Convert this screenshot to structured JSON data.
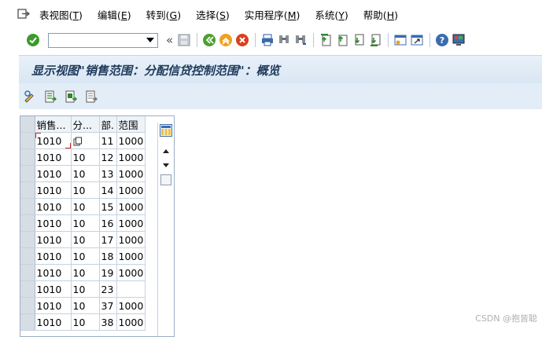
{
  "menu": {
    "items": [
      {
        "label": "表视图(",
        "key": "T",
        "end": ")"
      },
      {
        "label": "编辑(",
        "key": "E",
        "end": ")"
      },
      {
        "label": "转到(",
        "key": "G",
        "end": ")"
      },
      {
        "label": "选择(",
        "key": "S",
        "end": ")"
      },
      {
        "label": "实用程序(",
        "key": "M",
        "end": ")"
      },
      {
        "label": "系统(",
        "key": "Y",
        "end": ")"
      },
      {
        "label": "帮助(",
        "key": "H",
        "end": ")"
      }
    ]
  },
  "toolbar": {
    "command_value": "",
    "collapse_glyph": "«"
  },
  "title": "显示视图\"销售范围：分配信贷控制范围\"：概览",
  "table": {
    "columns": [
      "销售...",
      "分...",
      "部.",
      "范围"
    ],
    "rows": [
      [
        "1010",
        "",
        "11",
        "1000"
      ],
      [
        "1010",
        "10",
        "12",
        "1000"
      ],
      [
        "1010",
        "10",
        "13",
        "1000"
      ],
      [
        "1010",
        "10",
        "14",
        "1000"
      ],
      [
        "1010",
        "10",
        "15",
        "1000"
      ],
      [
        "1010",
        "10",
        "16",
        "1000"
      ],
      [
        "1010",
        "10",
        "17",
        "1000"
      ],
      [
        "1010",
        "10",
        "18",
        "1000"
      ],
      [
        "1010",
        "10",
        "19",
        "1000"
      ],
      [
        "1010",
        "10",
        "23",
        ""
      ],
      [
        "1010",
        "10",
        "37",
        "1000"
      ],
      [
        "1010",
        "10",
        "38",
        "1000"
      ]
    ]
  },
  "watermark": "CSDN @抱皆聪",
  "colors": {
    "title_text": "#1f3a5c",
    "header_bg": "#e3edf7",
    "ok_green": "#3a9a2a",
    "cancel_red": "#d9411e"
  }
}
